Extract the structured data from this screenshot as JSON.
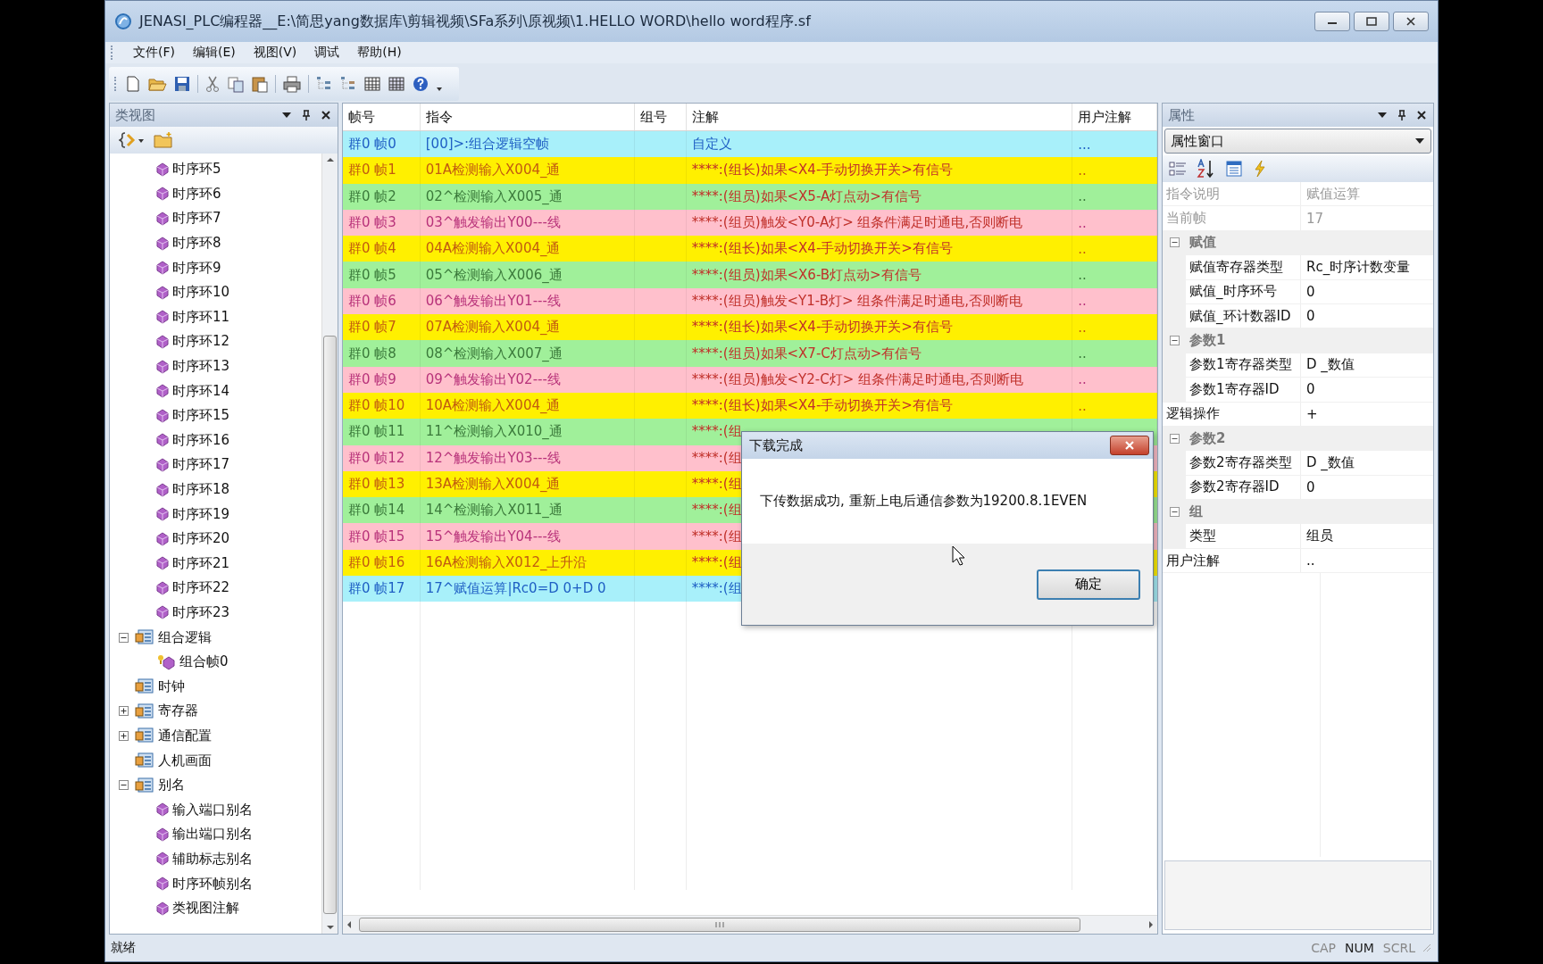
{
  "window": {
    "title": "JENASI_PLC编程器__E:\\简思yang数据库\\剪辑视频\\SFa系列\\原视频\\1.HELLO WORD\\hello word程序.sf"
  },
  "menu": [
    "文件(F)",
    "编辑(E)",
    "视图(V)",
    "调试",
    "帮助(H)"
  ],
  "class_view": {
    "title": "类视图",
    "tree": [
      {
        "children": [
          {
            "label": "时序环5",
            "kind": "leaf"
          },
          {
            "label": "时序环6",
            "kind": "leaf"
          },
          {
            "label": "时序环7",
            "kind": "leaf"
          },
          {
            "label": "时序环8",
            "kind": "leaf"
          },
          {
            "label": "时序环9",
            "kind": "leaf"
          },
          {
            "label": "时序环10",
            "kind": "leaf"
          },
          {
            "label": "时序环11",
            "kind": "leaf"
          },
          {
            "label": "时序环12",
            "kind": "leaf"
          },
          {
            "label": "时序环13",
            "kind": "leaf"
          },
          {
            "label": "时序环14",
            "kind": "leaf"
          },
          {
            "label": "时序环15",
            "kind": "leaf"
          },
          {
            "label": "时序环16",
            "kind": "leaf"
          },
          {
            "label": "时序环17",
            "kind": "leaf"
          },
          {
            "label": "时序环18",
            "kind": "leaf"
          },
          {
            "label": "时序环19",
            "kind": "leaf"
          },
          {
            "label": "时序环20",
            "kind": "leaf"
          },
          {
            "label": "时序环21",
            "kind": "leaf"
          },
          {
            "label": "时序环22",
            "kind": "leaf"
          },
          {
            "label": "时序环23",
            "kind": "leaf"
          }
        ]
      },
      {
        "label": "组合逻辑",
        "kind": "group",
        "expanded": true,
        "children": [
          {
            "label": "组合帧0",
            "kind": "frame"
          }
        ]
      },
      {
        "label": "时钟",
        "kind": "group"
      },
      {
        "label": "寄存器",
        "kind": "group",
        "expanded": false
      },
      {
        "label": "通信配置",
        "kind": "group",
        "expanded": false
      },
      {
        "label": "人机画面",
        "kind": "group"
      },
      {
        "label": "别名",
        "kind": "group",
        "expanded": true,
        "children": [
          {
            "label": "输入端口别名",
            "kind": "leaf"
          },
          {
            "label": "输出端口别名",
            "kind": "leaf"
          },
          {
            "label": "辅助标志别名",
            "kind": "leaf"
          },
          {
            "label": "时序环帧别名",
            "kind": "leaf"
          },
          {
            "label": "类视图注解",
            "kind": "leaf"
          }
        ]
      }
    ]
  },
  "table": {
    "columns": [
      "帧号",
      "指令",
      "组号",
      "注解",
      "用户注解"
    ],
    "rows": [
      {
        "kind": "assign",
        "frame": "群0 帧0",
        "instruction": "[00]>:组合逻辑空帧",
        "note": "自定义",
        "user_note": "..."
      },
      {
        "kind": "leader",
        "frame": "群0 帧1",
        "instruction": "01A检测输入X004_通",
        "note": "****:(组长)如果<X4-手动切换开关>有信号",
        "user_note": ".."
      },
      {
        "kind": "input",
        "frame": "群0 帧2",
        "instruction": "02^检测输入X005_通",
        "note": "****:(组员)如果<X5-A灯点动>有信号",
        "user_note": ".."
      },
      {
        "kind": "output",
        "frame": "群0 帧3",
        "instruction": "03^触发输出Y00---线",
        "note": "****:(组员)触发<Y0-A灯>    组条件满足时通电,否则断电",
        "user_note": ".."
      },
      {
        "kind": "leader",
        "frame": "群0 帧4",
        "instruction": "04A检测输入X004_通",
        "note": "****:(组长)如果<X4-手动切换开关>有信号",
        "user_note": ".."
      },
      {
        "kind": "input",
        "frame": "群0 帧5",
        "instruction": "05^检测输入X006_通",
        "note": "****:(组员)如果<X6-B灯点动>有信号",
        "user_note": ".."
      },
      {
        "kind": "output",
        "frame": "群0 帧6",
        "instruction": "06^触发输出Y01---线",
        "note": "****:(组员)触发<Y1-B灯>    组条件满足时通电,否则断电",
        "user_note": ".."
      },
      {
        "kind": "leader",
        "frame": "群0 帧7",
        "instruction": "07A检测输入X004_通",
        "note": "****:(组长)如果<X4-手动切换开关>有信号",
        "user_note": ".."
      },
      {
        "kind": "input",
        "frame": "群0 帧8",
        "instruction": "08^检测输入X007_通",
        "note": "****:(组员)如果<X7-C灯点动>有信号",
        "user_note": ".."
      },
      {
        "kind": "output",
        "frame": "群0 帧9",
        "instruction": "09^触发输出Y02---线",
        "note": "****:(组员)触发<Y2-C灯>    组条件满足时通电,否则断电",
        "user_note": ".."
      },
      {
        "kind": "leader",
        "frame": "群0 帧10",
        "instruction": "10A检测输入X004_通",
        "note": "****:(组长)如果<X4-手动切换开关>有信号",
        "user_note": ".."
      },
      {
        "kind": "input",
        "frame": "群0 帧11",
        "instruction": "11^检测输入X010_通",
        "note": "****:(组"
      },
      {
        "kind": "output",
        "frame": "群0 帧12",
        "instruction": "12^触发输出Y03---线",
        "note": "****:(组"
      },
      {
        "kind": "leader",
        "frame": "群0 帧13",
        "instruction": "13A检测输入X004_通",
        "note": "****:(组"
      },
      {
        "kind": "input",
        "frame": "群0 帧14",
        "instruction": "14^检测输入X011_通",
        "note": "****:(组"
      },
      {
        "kind": "output",
        "frame": "群0 帧15",
        "instruction": "15^触发输出Y04---线",
        "note": "****:(组"
      },
      {
        "kind": "leader",
        "frame": "群0 帧16",
        "instruction": "16A检测输入X012_上升沿",
        "note": "****:(组"
      },
      {
        "kind": "assign",
        "frame": "群0 帧17",
        "instruction": "17^赋值运算|Rc0=D 0+D 0",
        "note": "****:(组"
      }
    ]
  },
  "properties": {
    "title": "属性",
    "selector": "属性窗口",
    "items": [
      {
        "kind": "prop",
        "name": "指令说明",
        "value": "赋值运算",
        "disabled": true
      },
      {
        "kind": "prop",
        "name": "当前帧",
        "value": "17",
        "disabled": true
      },
      {
        "kind": "category",
        "name": "赋值",
        "expanded": true,
        "children": [
          {
            "kind": "prop",
            "name": "赋值寄存器类型",
            "value": "Rc_时序计数变量",
            "disabled": false
          },
          {
            "kind": "prop",
            "name": "赋值_时序环号",
            "value": "0",
            "disabled": false
          },
          {
            "kind": "prop",
            "name": "赋值_环计数器ID",
            "value": "0",
            "disabled": false
          }
        ]
      },
      {
        "kind": "category",
        "name": "参数1",
        "expanded": true,
        "children": [
          {
            "kind": "prop",
            "name": "参数1寄存器类型",
            "value": "D _数值",
            "disabled": false
          },
          {
            "kind": "prop",
            "name": "参数1寄存器ID",
            "value": "0",
            "disabled": false
          }
        ]
      },
      {
        "kind": "prop",
        "name": "逻辑操作",
        "value": "+",
        "disabled": false
      },
      {
        "kind": "category",
        "name": "参数2",
        "expanded": true,
        "children": [
          {
            "kind": "prop",
            "name": "参数2寄存器类型",
            "value": "D _数值",
            "disabled": false
          },
          {
            "kind": "prop",
            "name": "参数2寄存器ID",
            "value": "0",
            "disabled": false
          }
        ]
      },
      {
        "kind": "category",
        "name": "组",
        "expanded": true,
        "children": [
          {
            "kind": "prop",
            "name": "类型",
            "value": "组员",
            "disabled": false
          }
        ]
      },
      {
        "kind": "prop",
        "name": "用户注解",
        "value": "..",
        "disabled": false
      }
    ]
  },
  "dialog": {
    "title": "下载完成",
    "message": "下传数据成功, 重新上电后通信参数为19200.8.1EVEN",
    "button": "确定"
  },
  "status_bar": {
    "text": "就绪",
    "indicators": [
      {
        "label": "CAP",
        "on": false
      },
      {
        "label": "NUM",
        "on": true
      },
      {
        "label": "SCRL",
        "on": false
      }
    ]
  }
}
